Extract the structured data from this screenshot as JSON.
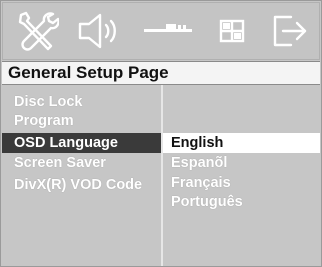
{
  "top_icons": [
    {
      "icon": "tools-icon",
      "active": true
    },
    {
      "icon": "speaker-icon",
      "active": false
    },
    {
      "icon": "video-display-icon",
      "active": false
    },
    {
      "icon": "preferences-icon",
      "active": false
    },
    {
      "icon": "exit-icon",
      "active": false
    }
  ],
  "page_title": "General Setup Page",
  "menu": {
    "items": [
      {
        "label": "Disc Lock"
      },
      {
        "label": "Program"
      },
      {
        "label": "OSD Language",
        "selected": true
      },
      {
        "label": "Screen Saver"
      },
      {
        "label": "DivX(R) VOD Code"
      }
    ]
  },
  "submenu": {
    "options": [
      {
        "label": "English",
        "selected": true
      },
      {
        "label": "Espanõl"
      },
      {
        "label": "Français"
      },
      {
        "label": "Português"
      }
    ]
  },
  "colors": {
    "background": "#c6c6c6",
    "title_strip": "#f4f4f4",
    "selected_left": "#3a3a3a",
    "selected_right": "#ffffff",
    "menu_text": "#ffffff"
  }
}
